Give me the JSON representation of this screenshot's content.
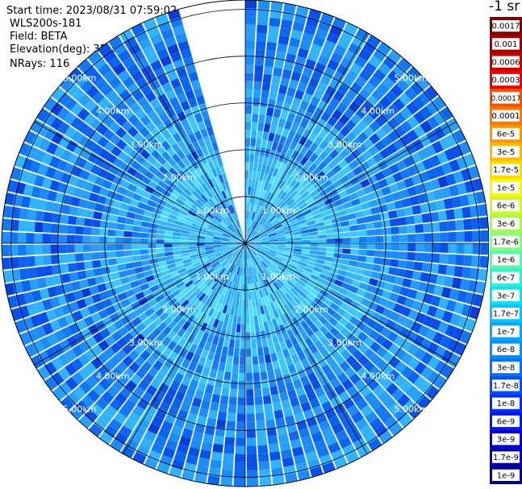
{
  "header": {
    "start_time": "Start time: 2023/08/31 07:59:02",
    "instrument": "WLS200s-181",
    "field": "Field: BETA",
    "elevation": "Elevation(deg): 35.30",
    "nrays": "NRays: 116"
  },
  "colorbar": {
    "title": "-1 sr",
    "labels": [
      "0.0017",
      "0.001",
      "0.0006",
      "0.0003",
      "0.00017",
      "0.0001",
      "6e-5",
      "3e-5",
      "1.7e-5",
      "1e-5",
      "6e-6",
      "3e-6",
      "1.7e-6",
      "1e-6",
      "6e-7",
      "3e-7",
      "1.7e-7",
      "1e-7",
      "6e-8",
      "3e-8",
      "1.7e-8",
      "1e-8",
      "6e-9",
      "3e-9",
      "1.7e-9",
      "1e-9"
    ],
    "colors": [
      "#800000",
      "#a00000",
      "#c80000",
      "#f00000",
      "#ff5000",
      "#ff7800",
      "#ff9800",
      "#ffb800",
      "#ffd800",
      "#f8f800",
      "#d0f820",
      "#a8f848",
      "#80ff80",
      "#58f8a8",
      "#30f0d0",
      "#10e0f0",
      "#00c8ff",
      "#00a8ff",
      "#0090ff",
      "#0070ff",
      "#0050ff",
      "#0030f8",
      "#0018e8",
      "#0000d0",
      "#0000b0",
      "#000090"
    ]
  },
  "chart_data": {
    "type": "heatmap",
    "subtype": "polar-ppi",
    "range_rings_km": [
      1,
      2,
      3,
      4,
      5
    ],
    "ring_labels": [
      "1.00km",
      "2.00km",
      "3.00km",
      "4.00km",
      "5.00km"
    ],
    "max_range_km": 5.2,
    "nrays": 116,
    "missing_sector_deg": [
      345,
      360
    ],
    "azimuth_spokes_deg": [
      0,
      30,
      60,
      90,
      120,
      150,
      180,
      210,
      240,
      270,
      300,
      330
    ],
    "value_range": [
      1e-09,
      0.0017
    ],
    "dominant_value_band": [
      3e-08,
      6e-07
    ]
  }
}
